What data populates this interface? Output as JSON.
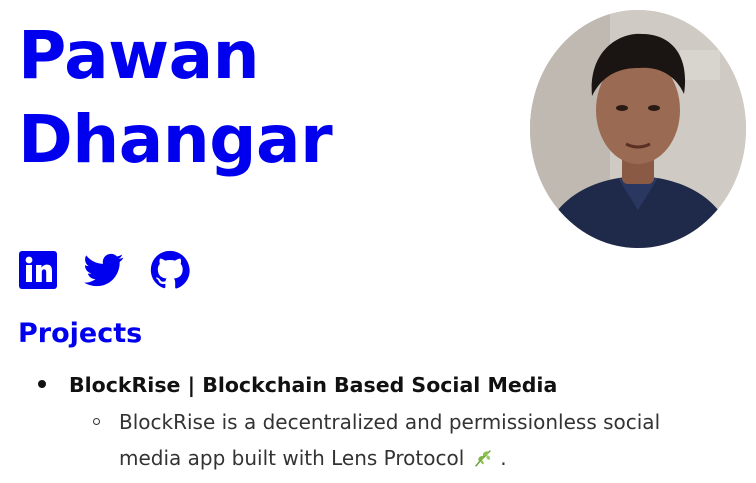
{
  "header": {
    "first_name": "Pawan",
    "last_name": "Dhangar"
  },
  "avatar": {
    "icon": "profile-photo"
  },
  "socials": [
    {
      "name": "LinkedIn",
      "icon": "linkedin-icon"
    },
    {
      "name": "Twitter",
      "icon": "twitter-icon"
    },
    {
      "name": "GitHub",
      "icon": "github-icon"
    }
  ],
  "projects": {
    "heading": "Projects",
    "items": [
      {
        "title": "BlockRise | Blockchain Based Social Media",
        "description": "BlockRise is a decentralized and permissionless social media app built with Lens Protocol",
        "trailing_icon": "leaf-icon",
        "trailing_text": "."
      }
    ]
  },
  "colors": {
    "link_blue": "#0000ee",
    "text_dark": "#111111",
    "text_body": "#333333",
    "leaf_green": "#7cb342"
  }
}
